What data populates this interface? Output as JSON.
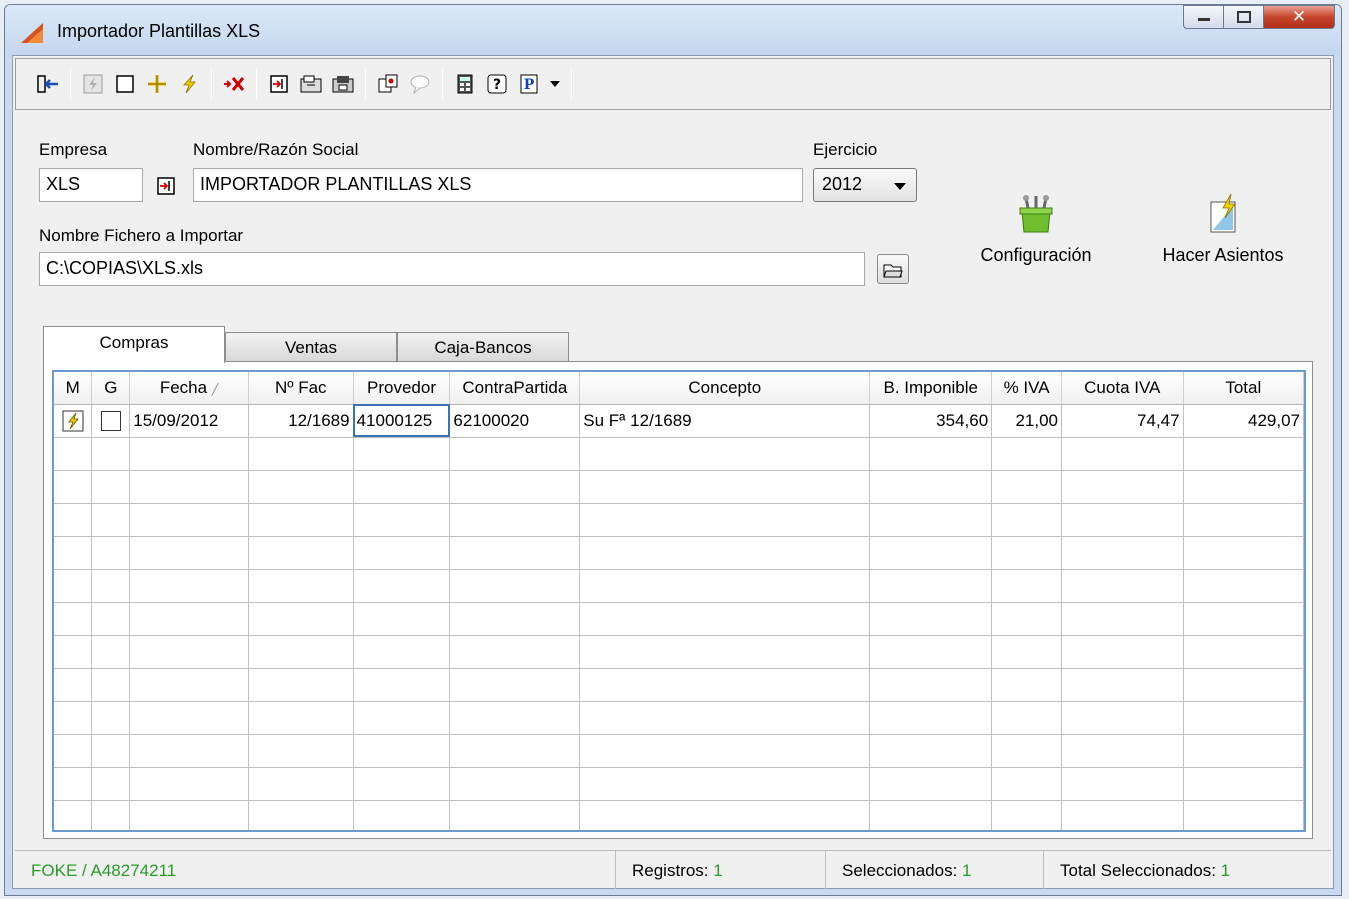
{
  "window": {
    "title": "Importador Plantillas XLS"
  },
  "toolbar": {
    "icons": [
      "exit-icon",
      "lightning-disabled-icon",
      "blank-icon",
      "add-icon",
      "lightning-icon",
      "delete-icon",
      "import-icon",
      "open-folder-icon",
      "save-folder-icon",
      "copy-icon",
      "balloon-icon",
      "calculator-icon",
      "help-icon",
      "print-icon",
      "dropdown-icon"
    ]
  },
  "form": {
    "empresa_label": "Empresa",
    "empresa_value": "XLS",
    "nombre_label": "Nombre/Razón Social",
    "nombre_value": "IMPORTADOR PLANTILLAS XLS",
    "ejercicio_label": "Ejercicio",
    "ejercicio_value": "2012",
    "fichero_label": "Nombre Fichero a Importar",
    "fichero_value": "C:\\COPIAS\\XLS.xls"
  },
  "buttons": {
    "configuracion": "Configuración",
    "hacer_asientos": "Hacer Asientos"
  },
  "tabs": [
    "Compras",
    "Ventas",
    "Caja-Bancos"
  ],
  "grid": {
    "columns": [
      "M",
      "G",
      "Fecha",
      "Nº Fac",
      "Provedor",
      "ContraPartida",
      "Concepto",
      "B. Imponible",
      "% IVA",
      "Cuota IVA",
      "Total"
    ],
    "rows": [
      {
        "fecha": "15/09/2012",
        "nfac": "12/1689",
        "provedor": "41000125",
        "contrapartida": "62100020",
        "concepto": "Su Fª 12/1689",
        "base": "354,60",
        "iva": "21,00",
        "cuota": "74,47",
        "total": "429,07"
      }
    ]
  },
  "status": {
    "company": "FOKE / A48274211",
    "registros_label": "Registros:",
    "registros_value": "1",
    "seleccionados_label": "Seleccionados:",
    "seleccionados_value": "1",
    "total_label": "Total Seleccionados:",
    "total_value": "1"
  },
  "colors": {
    "accent_green": "#2a9a2a",
    "grid_border": "#6a9bd1",
    "close_red": "#c6452d"
  }
}
